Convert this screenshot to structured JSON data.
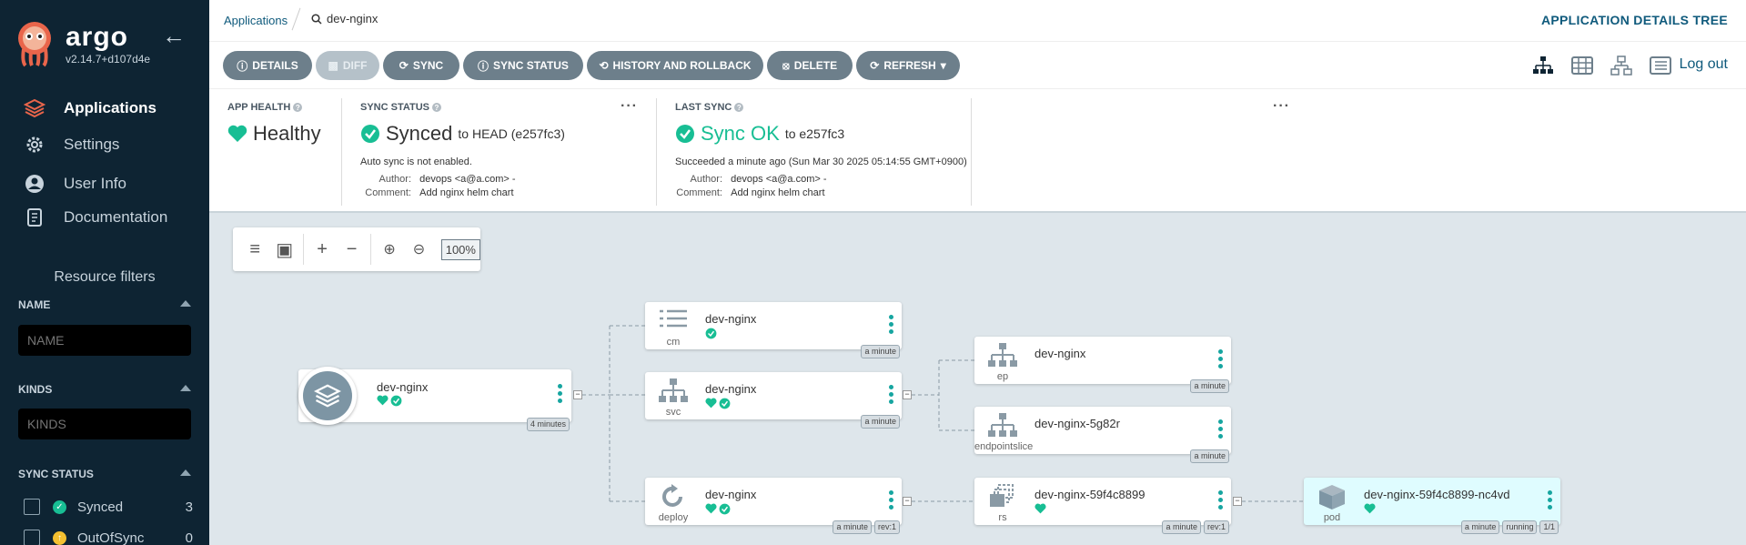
{
  "sidebar": {
    "brand": "argo",
    "version": "v2.14.7+d107d4e",
    "nav": [
      {
        "label": "Applications",
        "icon": "layers-icon",
        "active": true
      },
      {
        "label": "Settings",
        "icon": "gear-icon"
      },
      {
        "label": "User Info",
        "icon": "user-icon"
      },
      {
        "label": "Documentation",
        "icon": "book-icon"
      }
    ],
    "resource_filters_title": "Resource filters",
    "name_section": "NAME",
    "name_placeholder": "NAME",
    "kinds_section": "KINDS",
    "kinds_placeholder": "KINDS",
    "sync_status_section": "SYNC STATUS",
    "sync_filters": [
      {
        "label": "Synced",
        "count": "3",
        "color": "#18be94"
      },
      {
        "label": "OutOfSync",
        "count": "0",
        "color": "#f4c030"
      }
    ]
  },
  "topbar": {
    "breadcrumb_apps": "Applications",
    "search_value": "dev-nginx",
    "page_title": "APPLICATION DETAILS TREE"
  },
  "actions": {
    "details": "DETAILS",
    "diff": "DIFF",
    "sync": "SYNC",
    "sync_status": "SYNC STATUS",
    "history": "HISTORY AND ROLLBACK",
    "delete": "DELETE",
    "refresh": "REFRESH",
    "logout": "Log out"
  },
  "status": {
    "app_health_label": "APP HEALTH",
    "app_health_value": "Healthy",
    "sync_status_label": "SYNC STATUS",
    "sync_status_value": "Synced",
    "sync_status_target": "to HEAD (e257fc3)",
    "auto_sync": "Auto sync is not enabled.",
    "sync_author_key": "Author:",
    "sync_author_val": "devops <a@a.com> -",
    "sync_comment_key": "Comment:",
    "sync_comment_val": "Add nginx helm chart",
    "last_sync_label": "LAST SYNC",
    "last_sync_value": "Sync OK",
    "last_sync_target": "to e257fc3",
    "last_sync_when": "Succeeded a minute ago (Sun Mar 30 2025 05:14:55 GMT+0900)",
    "last_author_key": "Author:",
    "last_author_val": "devops <a@a.com> -",
    "last_comment_key": "Comment:",
    "last_comment_val": "Add nginx helm chart",
    "green": "#18be94"
  },
  "zoom": {
    "level": "100%"
  },
  "tree": {
    "root": {
      "name": "dev-nginx",
      "age": "4 minutes"
    },
    "cm": {
      "name": "dev-nginx",
      "kind": "cm",
      "age": "a minute"
    },
    "svc": {
      "name": "dev-nginx",
      "kind": "svc",
      "age": "a minute"
    },
    "deploy": {
      "name": "dev-nginx",
      "kind": "deploy",
      "age": "a minute",
      "rev": "rev:1"
    },
    "ep": {
      "name": "dev-nginx",
      "kind": "ep",
      "age": "a minute"
    },
    "endpointslice": {
      "name": "dev-nginx-5g82r",
      "kind": "endpointslice",
      "age": "a minute"
    },
    "rs": {
      "name": "dev-nginx-59f4c8899",
      "kind": "rs",
      "age": "a minute",
      "rev": "rev:1"
    },
    "pod": {
      "name": "dev-nginx-59f4c8899-nc4vd",
      "kind": "pod",
      "age": "a minute",
      "state": "running",
      "ready": "1/1"
    }
  }
}
